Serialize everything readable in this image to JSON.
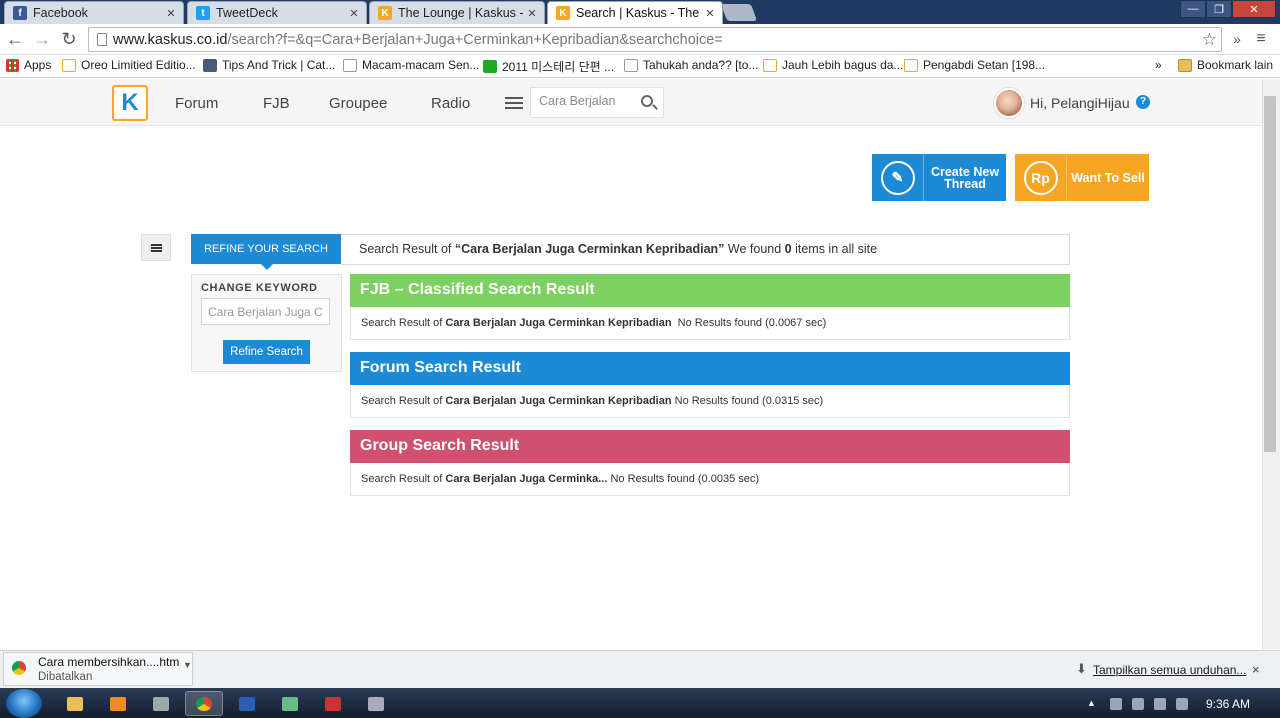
{
  "browser": {
    "tabs": [
      {
        "title": "Facebook",
        "favicon": "#3b5998",
        "glyph": "f"
      },
      {
        "title": "TweetDeck",
        "favicon": "#1da1f2",
        "glyph": "t"
      },
      {
        "title": "The Lounge | Kaskus - The",
        "favicon": "#f6a623",
        "glyph": "K"
      },
      {
        "title": "Search | Kaskus - The Larg",
        "favicon": "#f6a623",
        "glyph": "K"
      }
    ],
    "url_host": "www.kaskus.co.id",
    "url_path": "/search?f=&q=Cara+Berjalan+Juga+Cerminkan+Kepribadian&searchchoice=",
    "bookmarks": [
      {
        "label": "Apps"
      },
      {
        "label": "Oreo Limitied Editio..."
      },
      {
        "label": "Tips And Trick | Cat..."
      },
      {
        "label": "Macam-macam Sen..."
      },
      {
        "label": "2011 미스테리 단편 ..."
      },
      {
        "label": "Tahukah anda?? [to..."
      },
      {
        "label": "Jauh Lebih bagus da..."
      },
      {
        "label": "Pengabdi Setan [198..."
      }
    ],
    "more_bookmarks": "»",
    "other_bookmarks": "Bookmark lain"
  },
  "header": {
    "logo_glyph": "K",
    "nav": [
      "Forum",
      "FJB",
      "Groupee",
      "Radio"
    ],
    "search_value": "Cara Berjalan",
    "greeting": "Hi, PelangiHijau",
    "help": "?"
  },
  "actions": {
    "create_thread": "Create New Thread",
    "create_icon_glyph": "✎",
    "want_to_sell": "Want To Sell",
    "sell_icon_glyph": "Rp"
  },
  "refine": {
    "header": "REFINE YOUR SEARCH",
    "change_keyword_label": "CHANGE KEYWORD",
    "keyword_value": "Cara Berjalan Juga Cerminkan Kepribadian",
    "button": "Refine Search"
  },
  "summary": {
    "prefix": "Search Result of ",
    "query_quoted": "“Cara Berjalan Juga Cerminkan Kepribadian”",
    "middle": " We found ",
    "count": "0",
    "suffix": " items in all site"
  },
  "sections": [
    {
      "title": "FJB – Classified Search Result",
      "color": "#7dd160",
      "prefix": "Search Result of ",
      "query": "Cara Berjalan Juga Cerminkan Kepribadian",
      "status": "  No Results found (0.0067 sec)"
    },
    {
      "title": "Forum Search Result",
      "color": "#1c8ad4",
      "prefix": "Search Result of ",
      "query": "Cara Berjalan Juga Cerminkan Kepribadian",
      "status": " No Results found (0.0315 sec)"
    },
    {
      "title": "Group Search Result",
      "color": "#d0506f",
      "prefix": "Search Result of ",
      "query": "Cara Berjalan Juga Cerminka...",
      "status": " No Results found (0.0035 sec)"
    }
  ],
  "download": {
    "filename": "Cara membersihkan....htm",
    "status": "Dibatalkan",
    "show_all": "Tampilkan semua unduhan...",
    "close": "×"
  },
  "taskbar": {
    "clock": "9:36 AM"
  }
}
